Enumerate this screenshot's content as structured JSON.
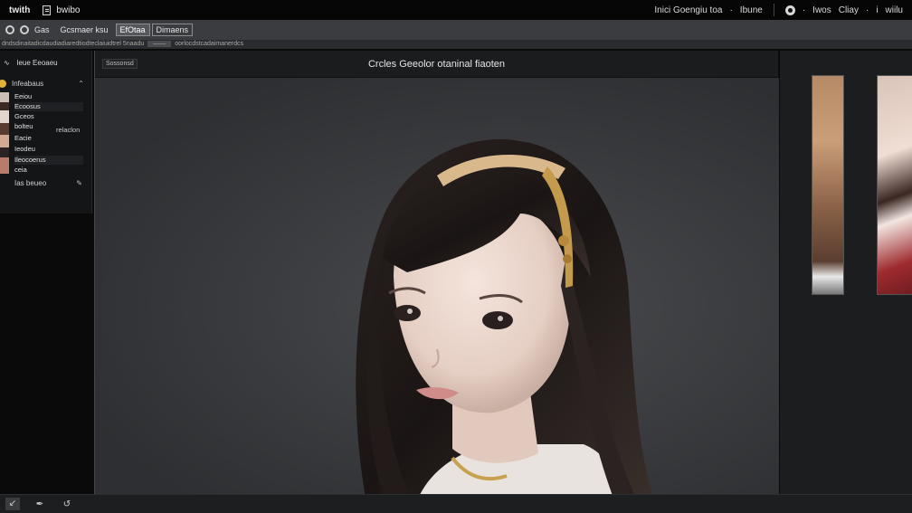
{
  "titlebar": {
    "app_name": "twith",
    "doc_name": "bwibo",
    "right_items": [
      "Inici Goengiu toa",
      "·",
      "Ibune",
      "·",
      "Iwos",
      "Cliay",
      "·",
      "i",
      "wiilu"
    ]
  },
  "toolbar": {
    "items": [
      "Gas"
    ],
    "menu_label": "Gcsmaer ksu",
    "box_items": [
      "EfOtaa",
      "Dimaens"
    ]
  },
  "crumbbar": {
    "text": "dndsdinaitadicdaudiadiaredtiodteclaiuidtrel 5naadu",
    "highlight": "——",
    "tail": "oorlocdstcadaimanerdcs"
  },
  "left_panel": {
    "header": "leue Eeoaeu",
    "section_label": "Infeabaus",
    "thumb_items": [
      {
        "label": "Eeiou",
        "highlight": false
      },
      {
        "label": "Ecoosus",
        "highlight": true
      },
      {
        "label": "Gceos",
        "highlight": false
      },
      {
        "label": "bolteu",
        "highlight": false
      },
      {
        "label": "Eacie",
        "highlight": false
      },
      {
        "label": "Ieodeu",
        "highlight": false
      },
      {
        "label": "Ileocoerus",
        "highlight": true
      },
      {
        "label": "ceia",
        "highlight": false
      }
    ],
    "side_label": "relaclon",
    "footer_label": "Ias beueo"
  },
  "canvas": {
    "layer_tag": "Sossonsd",
    "title": "Crcles Geeolor otaninal fiaoten"
  },
  "statusbar": {
    "icons": [
      "cursor-icon",
      "pen-tool-icon",
      "undo-icon"
    ]
  },
  "colors": {
    "accent_yellow": "#e4b336",
    "canvas_bg": "#3a3b3e",
    "panel_bg": "#141517"
  }
}
